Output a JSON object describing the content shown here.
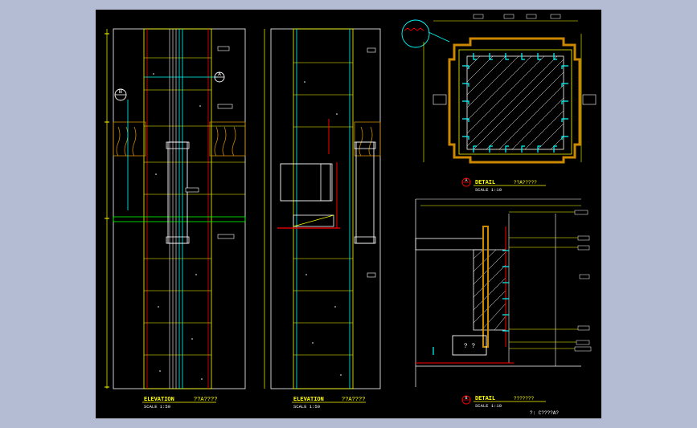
{
  "colors": {
    "background": "#b4bcd3",
    "sheet": "#000000",
    "yellow": "#ffff00",
    "white": "#ffffff",
    "cyan": "#00ffff",
    "red": "#ff0000",
    "orange": "#cc8800",
    "green": "#00ff00",
    "tag_bg": "#e8e8e8"
  },
  "views": {
    "elevation_a": {
      "title": "ELEVATION",
      "suffix": "??A????",
      "scale": "SCALE   1:50"
    },
    "elevation_b": {
      "title": "ELEVATION",
      "suffix": "??A????",
      "scale": "SCALE   1:50"
    },
    "detail_a": {
      "marker": "A",
      "title": "DETAIL",
      "suffix": "??A?????",
      "scale": "SCALE   1:10"
    },
    "detail_b": {
      "marker": "B",
      "title": "DETAIL",
      "suffix": "???????",
      "scale": "SCALE   1:10"
    }
  },
  "section_markers": {
    "a": "A",
    "b": "B"
  },
  "note_box": "? ?",
  "footer_note": "?: C????A?"
}
